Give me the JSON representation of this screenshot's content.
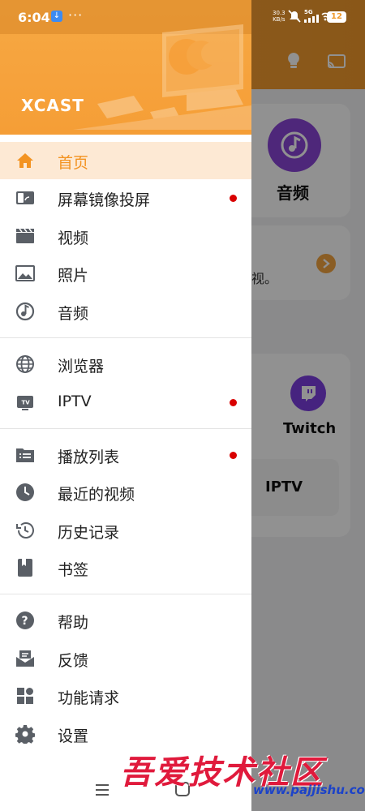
{
  "status_bar": {
    "time": "6:04",
    "more": "···",
    "net_speed_value": "30.3",
    "net_speed_unit": "KB/s",
    "network": "5G",
    "battery": "12"
  },
  "drawer": {
    "brand": "XCAST",
    "groups": [
      {
        "items": [
          {
            "label": "首页",
            "icon": "home-icon",
            "active": true,
            "dot": false
          },
          {
            "label": "屏幕镜像投屏",
            "icon": "screen-mirror-icon",
            "active": false,
            "dot": true
          },
          {
            "label": "视频",
            "icon": "clapperboard-icon",
            "active": false,
            "dot": false
          },
          {
            "label": "照片",
            "icon": "image-icon",
            "active": false,
            "dot": false
          },
          {
            "label": "音频",
            "icon": "music-disc-icon",
            "active": false,
            "dot": false
          }
        ]
      },
      {
        "items": [
          {
            "label": "浏览器",
            "icon": "globe-icon",
            "active": false,
            "dot": false
          },
          {
            "label": "IPTV",
            "icon": "tv-icon",
            "active": false,
            "dot": true
          }
        ]
      },
      {
        "items": [
          {
            "label": "播放列表",
            "icon": "playlist-folder-icon",
            "active": false,
            "dot": true
          },
          {
            "label": "最近的视频",
            "icon": "clock-icon",
            "active": false,
            "dot": false
          },
          {
            "label": "历史记录",
            "icon": "history-icon",
            "active": false,
            "dot": false
          },
          {
            "label": "书签",
            "icon": "bookmark-icon",
            "active": false,
            "dot": false
          }
        ]
      },
      {
        "items": [
          {
            "label": "帮助",
            "icon": "help-icon",
            "active": false,
            "dot": false
          },
          {
            "label": "反馈",
            "icon": "feedback-mail-icon",
            "active": false,
            "dot": false
          },
          {
            "label": "功能请求",
            "icon": "feature-grid-icon",
            "active": false,
            "dot": false
          },
          {
            "label": "设置",
            "icon": "gear-icon",
            "active": false,
            "dot": false
          }
        ]
      }
    ]
  },
  "background": {
    "audio_card_label": "音频",
    "note_text": "视。",
    "twitch_label": "Twitch",
    "iptv_label": "IPTV"
  },
  "watermark": {
    "text": "吾爱技术社区",
    "url": "www.pajjishu.com"
  },
  "colors": {
    "accent": "#f39321",
    "active_bg": "#fde9d4",
    "dot": "#d90000",
    "header_orange": "#f6a23c",
    "audio_purple": "#8a45d6",
    "twitch_purple": "#7b3fe0"
  }
}
